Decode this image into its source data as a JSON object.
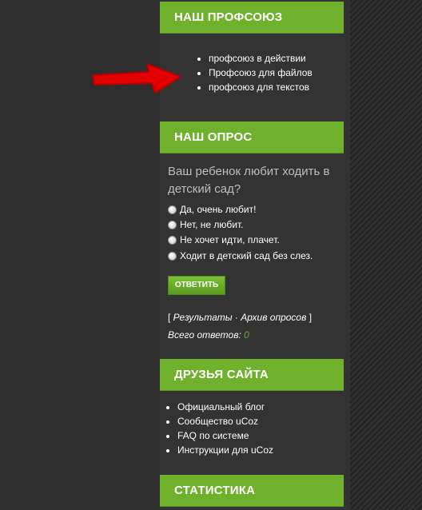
{
  "union": {
    "title": "НАШ ПРОФСОЮЗ",
    "links": [
      "профсоюз в действии",
      "Профсоюз для файлов",
      "профсоюз для текстов"
    ]
  },
  "poll": {
    "title": "НАШ ОПРОС",
    "question": "Ваш ребенок любит ходить в детский сад?",
    "options": [
      "Да, очень любит!",
      "Нет, не любит.",
      "Не хочет идти, плачет.",
      "Ходит в детский сад без слез."
    ],
    "vote_label": "ОТВЕТИТЬ",
    "open_bracket": "[ ",
    "results_link": "Результаты",
    "separator": " · ",
    "archive_link": "Архив опросов",
    "close_bracket": " ]",
    "total_label": "Всего ответов: ",
    "total_value": "0"
  },
  "friends": {
    "title": "ДРУЗЬЯ САЙТА",
    "links": [
      "Официальный блог",
      "Сообщество uCoz",
      "FAQ по системе",
      "Инструкции для uCoz"
    ]
  },
  "stats": {
    "title": "СТАТИСТИКА"
  },
  "colors": {
    "accent": "#6fb02c",
    "arrow": "#ff0000",
    "background": "#2e2e2e"
  }
}
